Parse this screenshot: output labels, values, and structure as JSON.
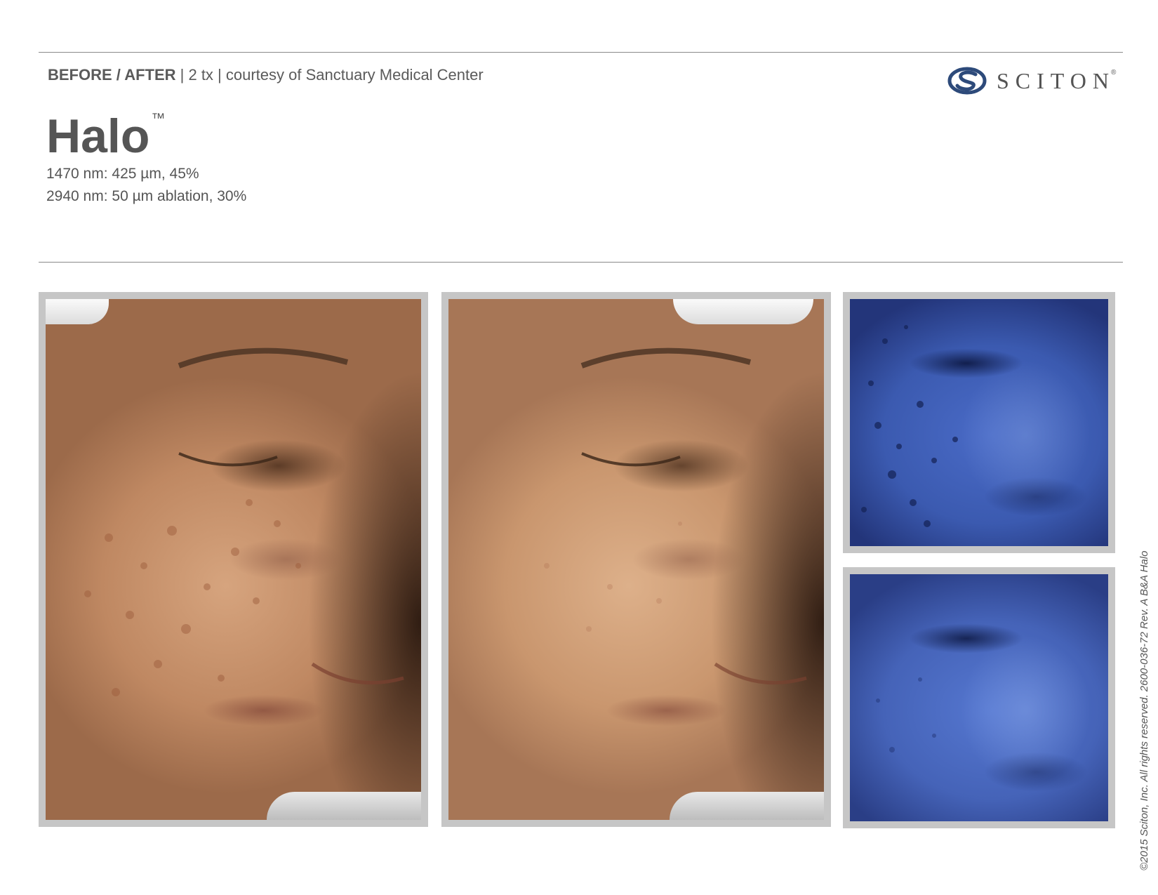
{
  "header": {
    "label_strong": "BEFORE / AFTER",
    "label_rest": " | 2 tx | courtesy of Sanctuary Medical Center"
  },
  "logo": {
    "wordmark": "SCITON",
    "mark": "®",
    "icon": "sciton-s-logo-icon",
    "color": "#2d4a7a"
  },
  "product": {
    "name": "Halo",
    "trademark": "™",
    "spec_1": "1470 nm: 425 µm, 45%",
    "spec_2": "2940 nm: 50 µm ablation, 30%"
  },
  "photos": [
    {
      "name": "before-photo",
      "kind": "color"
    },
    {
      "name": "after-photo",
      "kind": "color"
    },
    {
      "name": "before-uv-photo",
      "kind": "uv"
    },
    {
      "name": "after-uv-photo",
      "kind": "uv"
    }
  ],
  "footer": {
    "copyright": "©2015 Sciton, Inc. All rights reserved. 2600-036-72 Rev. A B&A Halo"
  }
}
